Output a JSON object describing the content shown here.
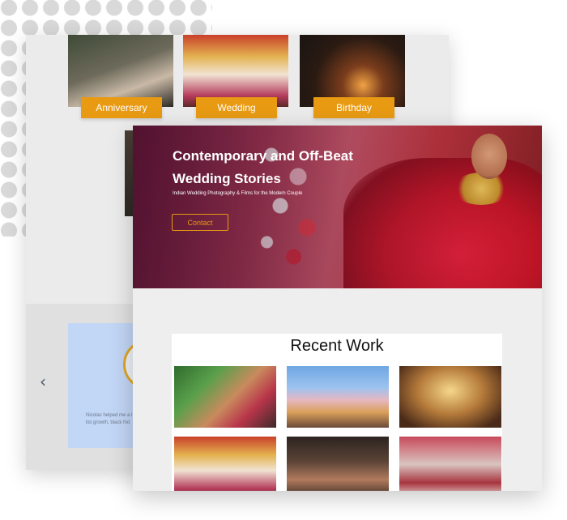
{
  "background_page": {
    "categories": [
      {
        "label": "Anniversary"
      },
      {
        "label": "Wedding"
      },
      {
        "label": "Birthday"
      }
    ],
    "testimonial": {
      "text": "Nicolas helped me a l\nlist growth, black frid"
    },
    "carousel_prev_icon": "chevron-left-icon"
  },
  "hero": {
    "title": "Contemporary and Off-Beat Wedding Stories",
    "subtitle": "Indian Wedding Photography & Films for the Modern Couple",
    "contact_label": "Contact"
  },
  "recent_work": {
    "title": "Recent Work",
    "items": [
      "photo-1",
      "photo-2",
      "photo-3",
      "photo-4",
      "photo-5",
      "photo-6"
    ]
  },
  "colors": {
    "accent": "#e89a13",
    "testimonial_bg": "#c2d6f5"
  }
}
